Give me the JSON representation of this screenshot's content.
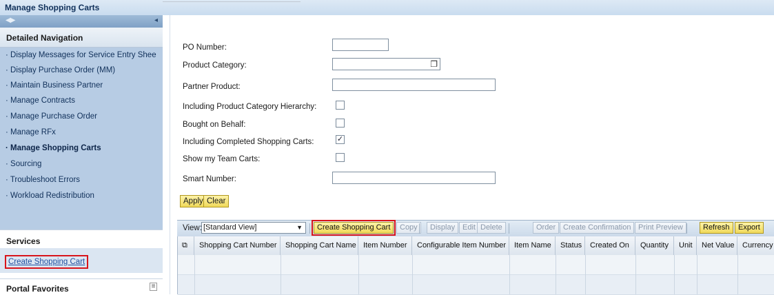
{
  "window": {
    "title": "Manage Shopping Carts"
  },
  "navigation": {
    "heading": "Detailed Navigation",
    "items": [
      {
        "label": "Display Messages for Service Entry Shee"
      },
      {
        "label": "Display Purchase Order (MM)"
      },
      {
        "label": "Maintain Business Partner"
      },
      {
        "label": "Manage Contracts"
      },
      {
        "label": "Manage Purchase Order"
      },
      {
        "label": "Manage RFx"
      },
      {
        "label": "Manage Shopping Carts",
        "active": true
      },
      {
        "label": "Sourcing"
      },
      {
        "label": "Troubleshoot Errors"
      },
      {
        "label": "Workload Redistribution"
      }
    ]
  },
  "services": {
    "heading": "Services",
    "link": "Create Shopping Cart"
  },
  "favorites": {
    "heading": "Portal Favorites"
  },
  "form": {
    "po_number": {
      "label": "PO Number:",
      "value": ""
    },
    "product_category": {
      "label": "Product Category:",
      "value": ""
    },
    "partner_product": {
      "label": "Partner Product:",
      "value": ""
    },
    "incl_hierarchy": {
      "label": "Including Product Category Hierarchy:",
      "checked": false
    },
    "bought_on_behalf": {
      "label": "Bought on Behalf:",
      "checked": false
    },
    "incl_completed": {
      "label": "Including Completed Shopping Carts:",
      "checked": true
    },
    "team_carts": {
      "label": "Show my Team Carts:",
      "checked": false
    },
    "smart_number": {
      "label": "Smart Number:",
      "value": ""
    },
    "apply_label": "Apply",
    "clear_label": "Clear"
  },
  "toolbar": {
    "view_label": "View:",
    "view_value": "[Standard View]",
    "create_label": "Create Shopping Cart",
    "copy_label": "Copy",
    "display_label": "Display",
    "edit_label": "Edit",
    "delete_label": "Delete",
    "order_label": "Order",
    "create_confirmation_label": "Create Confirmation",
    "print_preview_label": "Print Preview",
    "refresh_label": "Refresh",
    "export_label": "Export"
  },
  "table": {
    "columns": [
      "Shopping Cart Number",
      "Shopping Cart Name",
      "Item Number",
      "Configurable Item Number",
      "Item Name",
      "Status",
      "Created On",
      "Quantity",
      "Unit",
      "Net Value",
      "Currency"
    ]
  },
  "colors": {
    "highlight": "#d8141b",
    "nav_bg": "#b7cce4",
    "button_yellow": "#f0d95a"
  }
}
